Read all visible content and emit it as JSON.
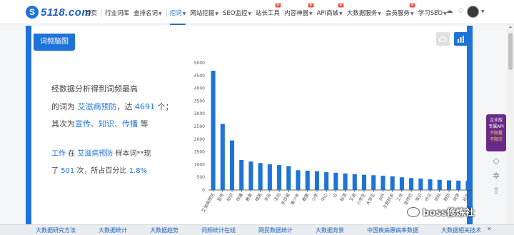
{
  "logo": {
    "mark": "S",
    "text": "5118.com"
  },
  "nav": [
    {
      "label": "首页",
      "caret": false,
      "active": false,
      "badge": ""
    },
    {
      "label": "行业词库",
      "caret": false,
      "active": false,
      "badge": ""
    },
    {
      "label": "查排名词",
      "caret": true,
      "active": false,
      "badge": ""
    },
    {
      "label": "挖词",
      "caret": true,
      "active": true,
      "badge": ""
    },
    {
      "label": "网站挖掘",
      "caret": true,
      "active": false,
      "badge": ""
    },
    {
      "label": "SEO监控",
      "caret": true,
      "active": false,
      "badge": ""
    },
    {
      "label": "站长工具",
      "caret": false,
      "active": false,
      "badge": "新"
    },
    {
      "label": "内容神器",
      "caret": true,
      "active": false,
      "badge": "新"
    },
    {
      "label": "API商城",
      "caret": true,
      "active": false,
      "badge": "新"
    },
    {
      "label": "大数据服务",
      "caret": true,
      "active": false,
      "badge": ""
    },
    {
      "label": "会员服务",
      "caret": true,
      "active": false,
      "badge": "新"
    },
    {
      "label": "学习SEO",
      "caret": true,
      "active": false,
      "badge": ""
    }
  ],
  "card": {
    "tab_label": "词频脑图"
  },
  "summary": {
    "line1": "经数据分析得到词频最高",
    "line2_prefix": "的词为",
    "top_word": "艾滋病预防",
    "line2_mid": "，达",
    "top_count": "4691",
    "line2_suffix": "个；",
    "line3_prefix": "其次为",
    "second_words": "宣传、知识、传播",
    "line3_suffix": "等"
  },
  "sample": {
    "word": "工作",
    "in": "在",
    "context": "艾滋病预防",
    "label": "样本词**现",
    "line2_prefix": "了",
    "count": "501",
    "line2_mid": "次，所占百分比",
    "percent": "1.8%"
  },
  "chart_data": {
    "type": "bar",
    "categories": [
      "艾滋病预防",
      "宣传",
      "知识",
      "传播",
      "教育",
      "措施",
      "手段",
      "活动",
      "手抄报",
      "青少年",
      "教案",
      "小学",
      "中心",
      "日",
      "标语",
      "艾滋",
      "小学生",
      "大学生",
      "ppt",
      "主题班会",
      "工作",
      "宣传栏",
      "常识",
      "作文",
      "资料",
      "预防",
      "同学",
      "社区"
    ],
    "values": [
      4691,
      2600,
      1950,
      1180,
      1120,
      1060,
      1010,
      980,
      940,
      780,
      760,
      740,
      700,
      680,
      650,
      620,
      600,
      580,
      560,
      540,
      500,
      470,
      450,
      420,
      400,
      380,
      370,
      360
    ],
    "ylim": [
      0,
      5000
    ],
    "yticks": [
      0,
      500,
      1000,
      1500,
      2000,
      2500,
      3000,
      3500,
      4000,
      4500,
      5000
    ],
    "color": "#1e73d9"
  },
  "side": {
    "badge_line1": "企业版",
    "badge_line2": "专属API",
    "badge_line3": "不限量",
    "badge_line4": "不限次"
  },
  "bottom": [
    "大数据研究方法",
    "大数据统计",
    "大数据趋势",
    "词频统计在线",
    "网民数据统计",
    "大数据背景",
    "中国疾病患病率数据",
    "大数据相关技术"
  ],
  "watermark": "boss修炼社"
}
